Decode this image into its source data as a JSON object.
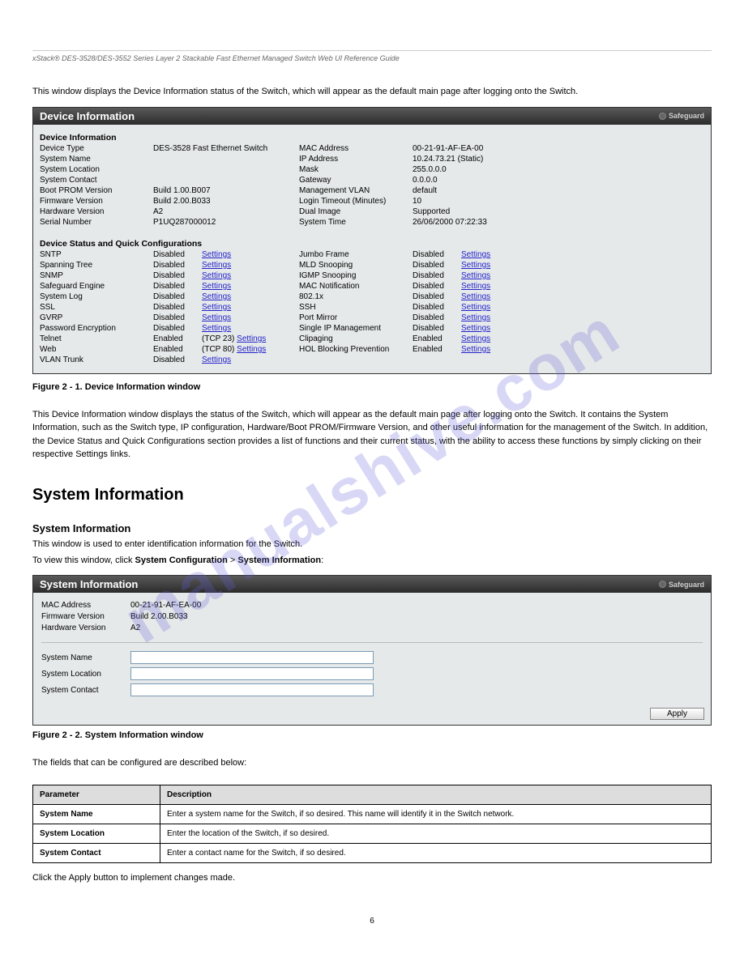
{
  "docHeader": "xStack® DES-3528/DES-3552 Series Layer 2 Stackable Fast Ethernet Managed Switch Web UI Reference Guide",
  "introText": "This window displays the Device Information status of the Switch, which will appear as the default main page after logging onto the Switch.",
  "panel1": {
    "title": "Device Information",
    "safeguard": "Safeguard",
    "section1": "Device Information",
    "info": {
      "deviceTypeL": "Device Type",
      "deviceTypeV": "DES-3528 Fast Ethernet Switch",
      "macL": "MAC Address",
      "macV": "00-21-91-AF-EA-00",
      "sysNameL": "System Name",
      "sysNameV": "",
      "ipL": "IP Address",
      "ipV": "10.24.73.21 (Static)",
      "sysLocL": "System Location",
      "sysLocV": "",
      "maskL": "Mask",
      "maskV": "255.0.0.0",
      "sysConL": "System Contact",
      "sysConV": "",
      "gwL": "Gateway",
      "gwV": "0.0.0.0",
      "bootL": "Boot PROM Version",
      "bootV": "Build 1.00.B007",
      "mvlanL": "Management VLAN",
      "mvlanV": "default",
      "fwL": "Firmware Version",
      "fwV": "Build 2.00.B033",
      "loginL": "Login Timeout (Minutes)",
      "loginV": "10",
      "hwL": "Hardware Version",
      "hwV": "A2",
      "dualL": "Dual Image",
      "dualV": "Supported",
      "snL": "Serial Number",
      "snV": "P1UQ287000012",
      "stimeL": "System Time",
      "stimeV": "26/06/2000 07:22:33"
    },
    "section2": "Device Status and Quick Configurations",
    "settings": "Settings",
    "status": {
      "sntpL": "SNTP",
      "sntpS": "Disabled",
      "jumboL": "Jumbo Frame",
      "jumboS": "Disabled",
      "stpL": "Spanning Tree",
      "stpS": "Disabled",
      "mldL": "MLD Snooping",
      "mldS": "Disabled",
      "snmpL": "SNMP",
      "snmpS": "Disabled",
      "igmpL": "IGMP Snooping",
      "igmpS": "Disabled",
      "sgL": "Safeguard Engine",
      "sgS": "Disabled",
      "macnL": "MAC Notification",
      "macnS": "Disabled",
      "slogL": "System Log",
      "slogS": "Disabled",
      "dot1xL": "802.1x",
      "dot1xS": "Disabled",
      "sslL": "SSL",
      "sslS": "Disabled",
      "sshL": "SSH",
      "sshS": "Disabled",
      "gvrpL": "GVRP",
      "gvrpS": "Disabled",
      "pmL": "Port Mirror",
      "pmS": "Disabled",
      "pweL": "Password Encryption",
      "pweS": "Disabled",
      "simL": "Single IP Management",
      "simS": "Disabled",
      "telnetL": "Telnet",
      "telnetS": "Enabled",
      "telnetExtra": "(TCP 23)",
      "clipL": "Clipaging",
      "clipS": "Enabled",
      "webL": "Web",
      "webS": "Enabled",
      "webExtra": "(TCP 80)",
      "holL": "HOL Blocking Prevention",
      "holS": "Enabled",
      "vtrunkL": "VLAN Trunk",
      "vtrunkS": "Disabled"
    }
  },
  "fig1": "Figure 2 - 1. Device Information window",
  "afterFig1": "This Device Information window displays the status of the Switch, which will appear as the default main page after logging onto the Switch. It contains the System Information, such as the Switch type, IP configuration, Hardware/Boot PROM/Firmware Version, and other useful information for the management of the Switch. In addition, the Device Status and Quick Configurations section provides a list of functions and their current status, with the ability to access these functions by simply clicking on their respective Settings links.",
  "sectionTitle": "System Information",
  "sub1": "System Information",
  "sub1Text": "This window is used to enter identification information for the Switch.",
  "nav": {
    "pre": "To view this window, click ",
    "b1": "System Configuration",
    "sep": " > ",
    "b2": "System Information"
  },
  "panel2": {
    "title": "System Information",
    "macL": "MAC Address",
    "macV": "00-21-91-AF-EA-00",
    "fwL": "Firmware Version",
    "fwV": "Build 2.00.B033",
    "hwL": "Hardware Version",
    "hwV": "A2",
    "sysNameL": "System Name",
    "sysLocL": "System Location",
    "sysConL": "System Contact",
    "apply": "Apply"
  },
  "fig2": "Figure 2 - 2. System Information window",
  "tableIntro": "The fields that can be configured are described below:",
  "table": {
    "h1": "Parameter",
    "h2": "Description",
    "r1a": "System Name",
    "r1b": "Enter a system name for the Switch, if so desired. This name will identify it in the Switch network.",
    "r2a": "System Location",
    "r2b": "Enter the location of the Switch, if so desired.",
    "r3a": "System Contact",
    "r3b": "Enter a contact name for the Switch, if so desired."
  },
  "afterTable": "Click the Apply button to implement changes made.",
  "pageNum": "6",
  "watermark": "manualshive.com"
}
